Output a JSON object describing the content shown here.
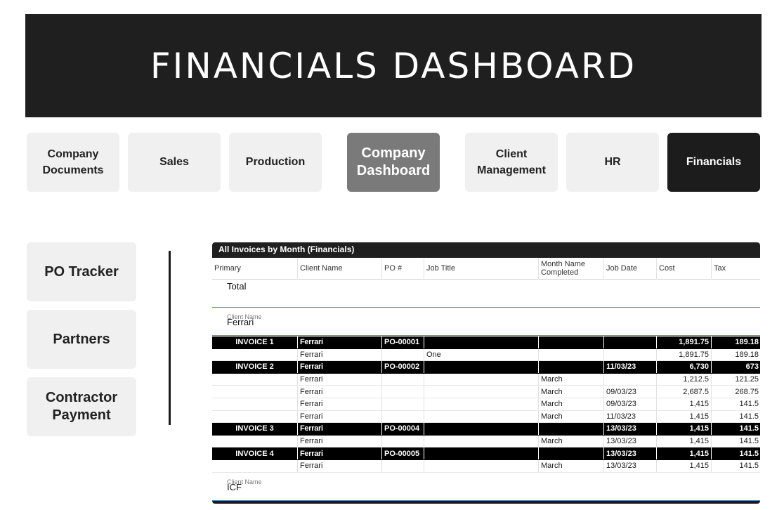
{
  "header": {
    "title": "FINANCIALS DASHBOARD"
  },
  "nav": {
    "items": [
      {
        "label": "Company Documents"
      },
      {
        "label": "Sales"
      },
      {
        "label": "Production"
      },
      {
        "label": "Company Dashboard"
      },
      {
        "label": "Client Management"
      },
      {
        "label": "HR"
      },
      {
        "label": "Financials"
      }
    ]
  },
  "side": {
    "items": [
      {
        "label": "PO Tracker"
      },
      {
        "label": "Partners"
      },
      {
        "label": "Contractor Payment"
      }
    ]
  },
  "report": {
    "title": "All Invoices by Month (Financials)",
    "columns": [
      "Primary",
      "Client Name",
      "PO #",
      "Job Title",
      "Month Name Completed",
      "Job Date",
      "Cost",
      "Tax"
    ],
    "total_label": "Total",
    "group_label": "Client Name",
    "groups": [
      {
        "client": "Ferrari",
        "rows": [
          {
            "kind": "inv",
            "cells": [
              "INVOICE 1",
              "Ferrari",
              "PO-00001",
              "",
              "",
              "",
              "1,891.75",
              "189.18"
            ]
          },
          {
            "kind": "row",
            "cells": [
              "",
              "Ferrari",
              "",
              "One",
              "",
              "",
              "1,891.75",
              "189.18"
            ]
          },
          {
            "kind": "inv",
            "cells": [
              "INVOICE 2",
              "Ferrari",
              "PO-00002",
              "",
              "",
              "11/03/23",
              "6,730",
              "673"
            ]
          },
          {
            "kind": "row",
            "cells": [
              "",
              "Ferrari",
              "",
              "",
              "March",
              "",
              "1,212.5",
              "121.25"
            ]
          },
          {
            "kind": "row",
            "cells": [
              "",
              "Ferrari",
              "",
              "",
              "March",
              "09/03/23",
              "2,687.5",
              "268.75"
            ]
          },
          {
            "kind": "row",
            "cells": [
              "",
              "Ferrari",
              "",
              "",
              "March",
              "09/03/23",
              "1,415",
              "141.5"
            ]
          },
          {
            "kind": "row",
            "cells": [
              "",
              "Ferrari",
              "",
              "",
              "March",
              "11/03/23",
              "1,415",
              "141.5"
            ]
          },
          {
            "kind": "inv",
            "cells": [
              "INVOICE 3",
              "Ferrari",
              "PO-00004",
              "",
              "",
              "13/03/23",
              "1,415",
              "141.5"
            ]
          },
          {
            "kind": "row",
            "cells": [
              "",
              "Ferrari",
              "",
              "",
              "March",
              "13/03/23",
              "1,415",
              "141.5"
            ]
          },
          {
            "kind": "inv",
            "cells": [
              "INVOICE 4",
              "Ferrari",
              "PO-00005",
              "",
              "",
              "13/03/23",
              "1,415",
              "141.5"
            ]
          },
          {
            "kind": "row",
            "cells": [
              "",
              "Ferrari",
              "",
              "",
              "March",
              "13/03/23",
              "1,415",
              "141.5"
            ]
          }
        ]
      },
      {
        "client": "ICF",
        "rows": []
      }
    ]
  }
}
